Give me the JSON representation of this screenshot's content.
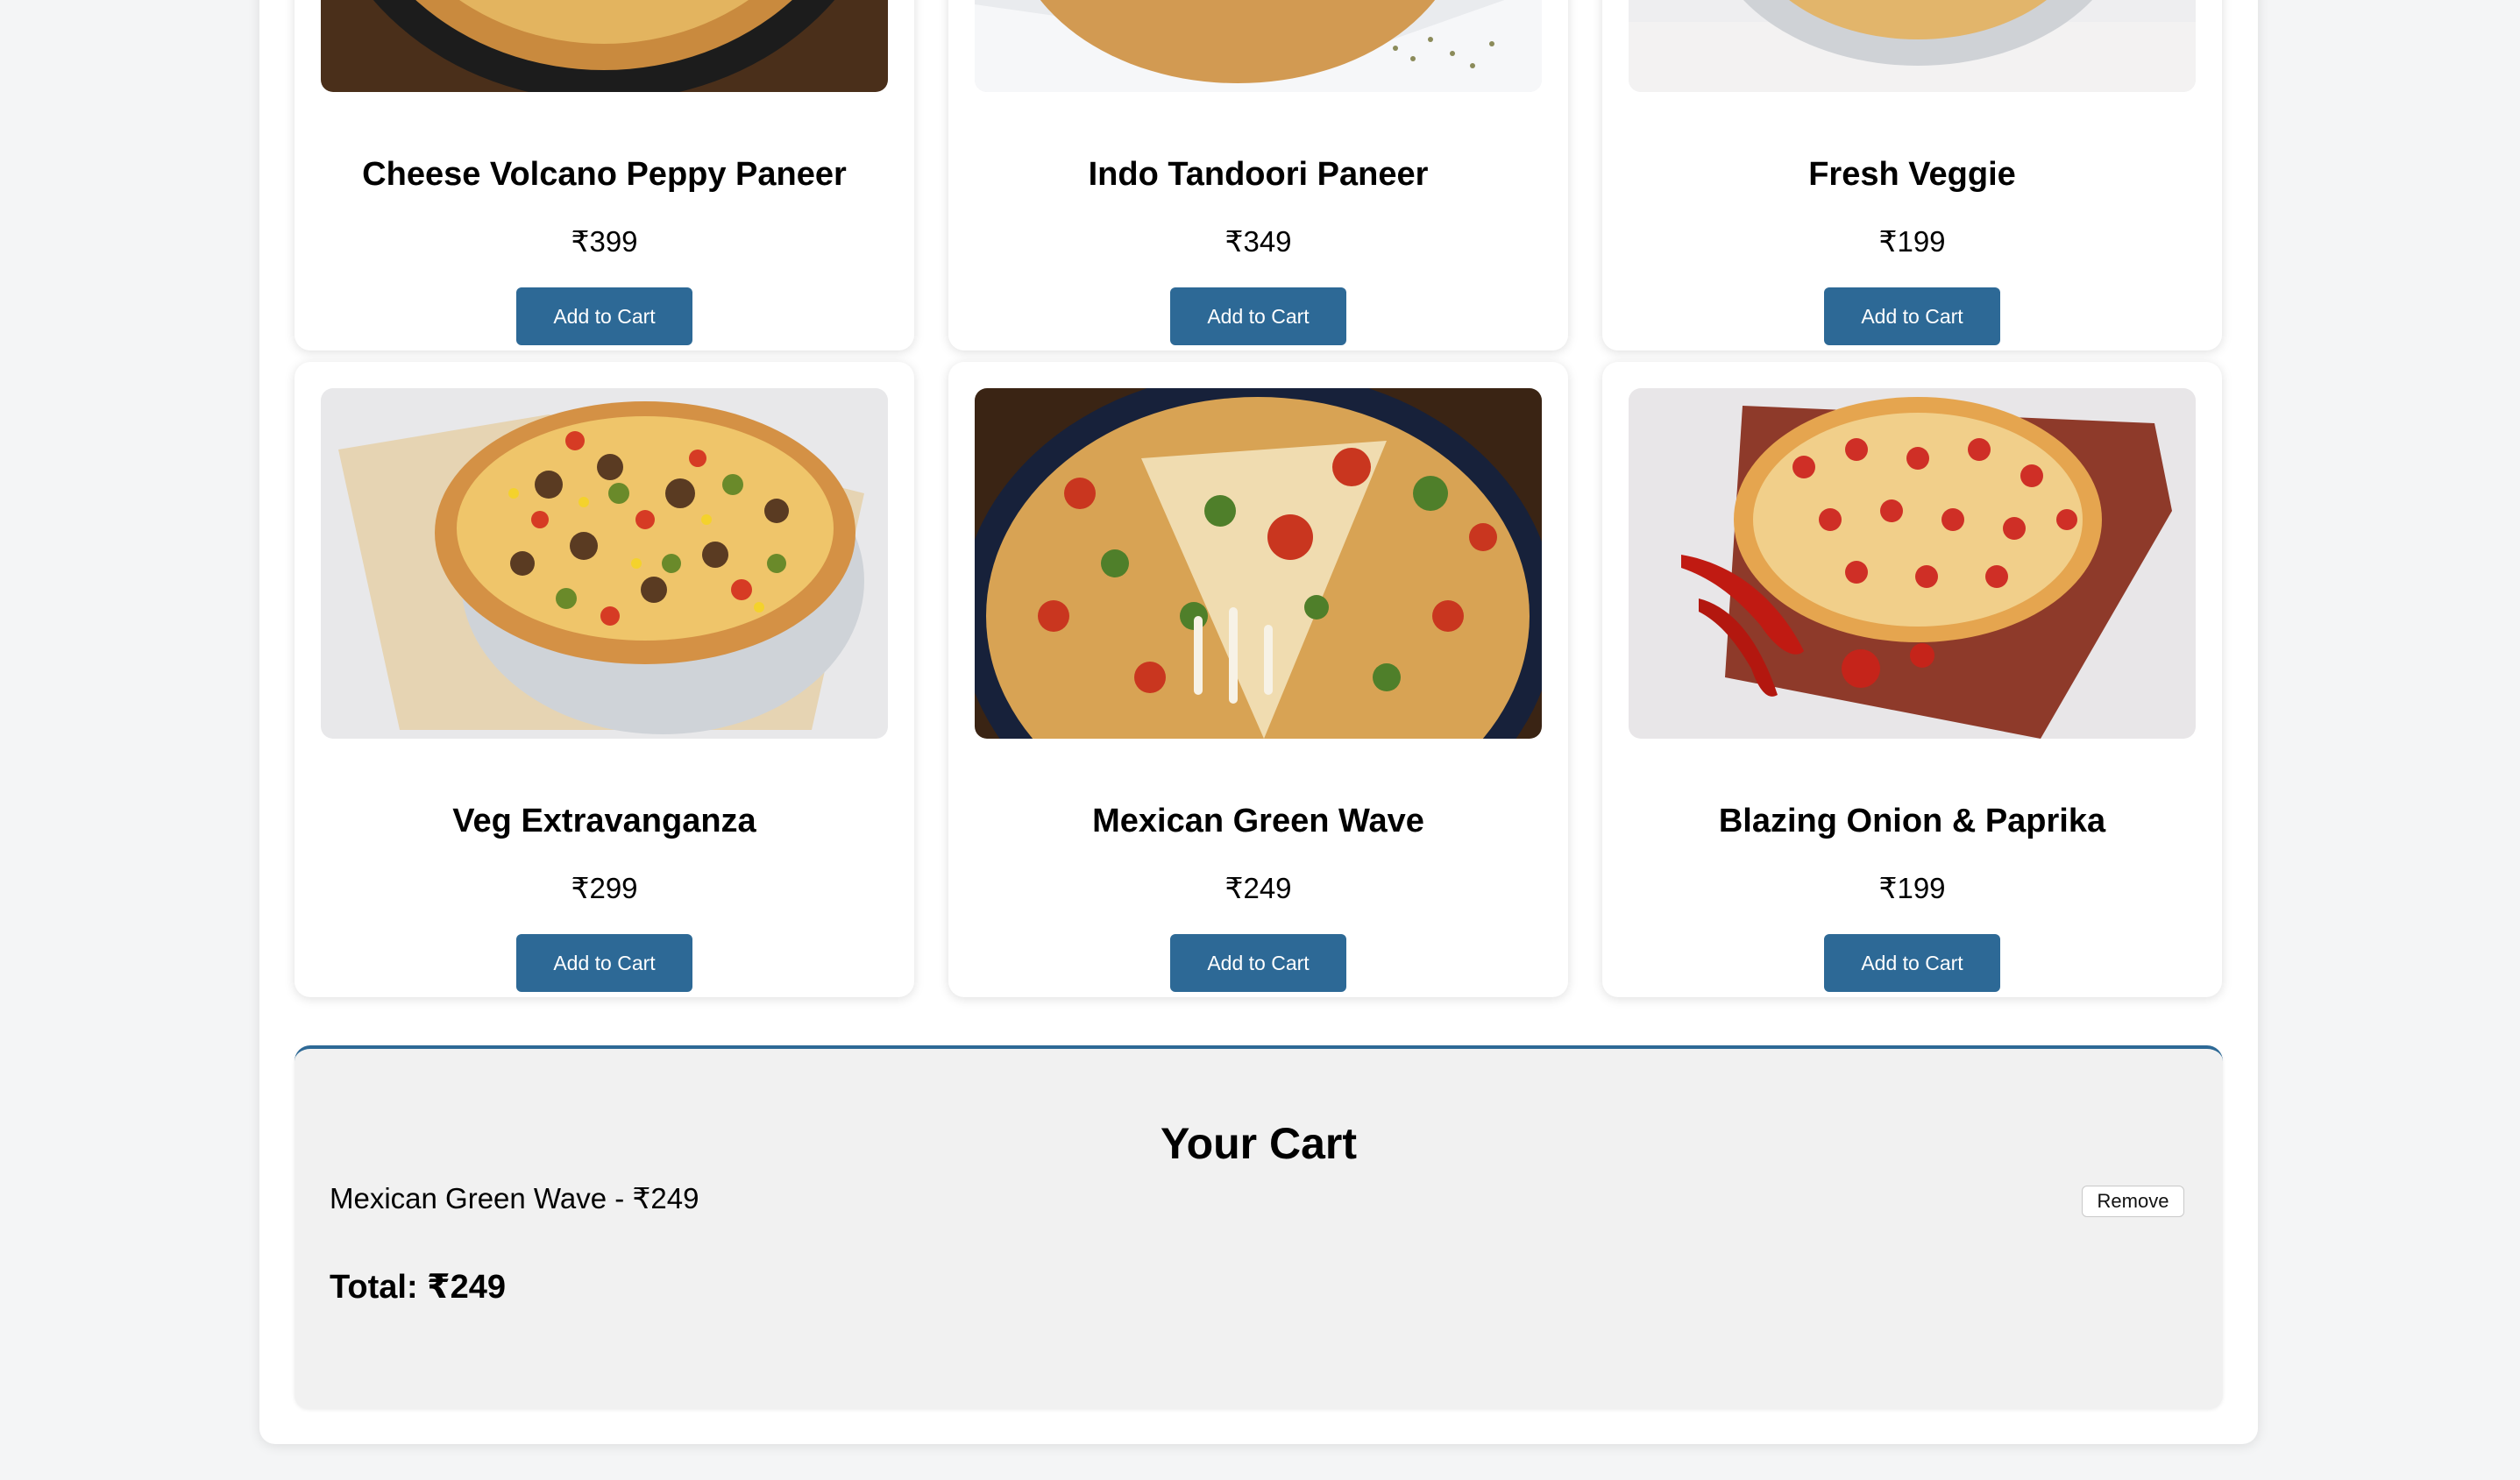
{
  "products": [
    {
      "name": "Cheese Volcano Peppy Paneer",
      "price": "₹399",
      "button": "Add to Cart",
      "image": "pizza-image"
    },
    {
      "name": "Indo Tandoori Paneer",
      "price": "₹349",
      "button": "Add to Cart",
      "image": "pizza-image"
    },
    {
      "name": "Fresh Veggie",
      "price": "₹199",
      "button": "Add to Cart",
      "image": "pizza-image"
    },
    {
      "name": "Veg Extravanganza",
      "price": "₹299",
      "button": "Add to Cart",
      "image": "pizza-image"
    },
    {
      "name": "Mexican Green Wave",
      "price": "₹249",
      "button": "Add to Cart",
      "image": "pizza-image"
    },
    {
      "name": "Blazing Onion & Paprika",
      "price": "₹199",
      "button": "Add to Cart",
      "image": "pizza-image"
    }
  ],
  "cart": {
    "title": "Your Cart",
    "items": [
      {
        "text": "Mexican Green Wave - ₹249",
        "remove_label": "Remove"
      }
    ],
    "total": "Total: ₹249"
  },
  "colors": {
    "accent": "#2d6996",
    "page_background": "#f4f5f6",
    "cart_background": "#f1f1f1"
  }
}
